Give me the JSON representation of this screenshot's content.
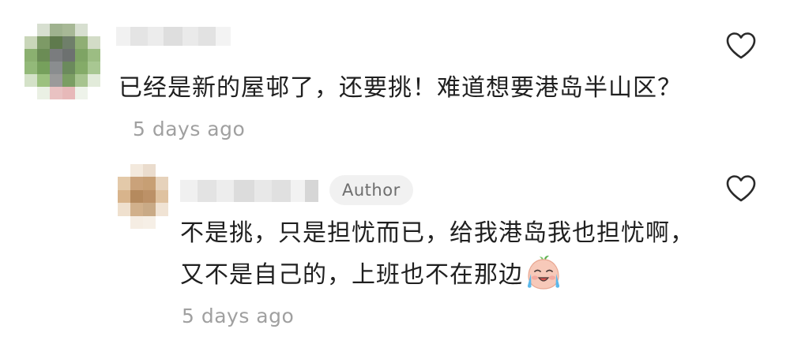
{
  "comments": [
    {
      "text": "已经是新的屋邨了，还要挑！难道想要港岛半山区？",
      "timestamp": "5 days ago",
      "like_icon": "heart-outline-icon"
    }
  ],
  "reply": {
    "badge": "Author",
    "text": "不是挑，只是担忧而已，给我港岛我也担忧啊，又不是自己的，上班也不在那边",
    "emoji": "crying-face-emoji",
    "timestamp": "5 days ago",
    "like_icon": "heart-outline-icon"
  },
  "colors": {
    "text": "#1f1f1f",
    "meta": "#a0a0a0",
    "badge_bg": "#f1f1f1",
    "badge_text": "#6e6e6e",
    "icon": "#2a2a2a"
  }
}
